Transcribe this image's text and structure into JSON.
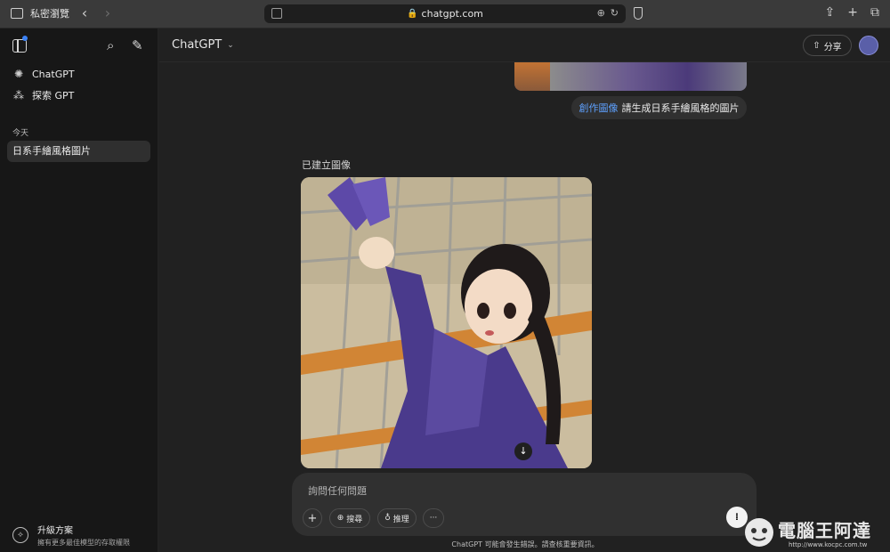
{
  "browser": {
    "private_label": "私密瀏覽",
    "back_icon": "‹",
    "forward_icon": "›",
    "url": "chatgpt.com",
    "lock_icon": "🔒",
    "translate_icon": "⊕",
    "reload_icon": "↻",
    "share_icon": "⇪",
    "new_tab_icon": "+",
    "tabs_icon": "⧉"
  },
  "sidebar": {
    "search_icon": "⌕",
    "edit_icon": "✎",
    "items": [
      {
        "label": "ChatGPT",
        "icon": "✺"
      },
      {
        "label": "探索 GPT",
        "icon": "⁂"
      }
    ],
    "section_today": "今天",
    "history": [
      {
        "label": "日系手繪風格圖片"
      }
    ],
    "upgrade": {
      "title": "升級方案",
      "subtitle": "擁有更多最佳模型的存取權限",
      "icon": "⟡"
    }
  },
  "header": {
    "model": "ChatGPT",
    "model_chevron": "⌄",
    "share_label": "分享",
    "share_icon": "⇧"
  },
  "conversation": {
    "user_message": {
      "tag": "創作圖像",
      "text": "請生成日系手繪風格的圖片"
    },
    "created_label": "已建立圖像",
    "download_icon": "↓"
  },
  "composer": {
    "placeholder": "詢問任何問題",
    "plus_icon": "+",
    "search_label": "搜尋",
    "search_icon": "⊕",
    "reason_label": "推理",
    "reason_icon": "♁",
    "more_icon": "···",
    "voice_icon": "⁞"
  },
  "disclaimer": "ChatGPT 可能會發生錯誤。請查核重要資訊。",
  "watermark": {
    "text": "電腦王阿達",
    "url": "http://www.kocpc.com.tw"
  }
}
